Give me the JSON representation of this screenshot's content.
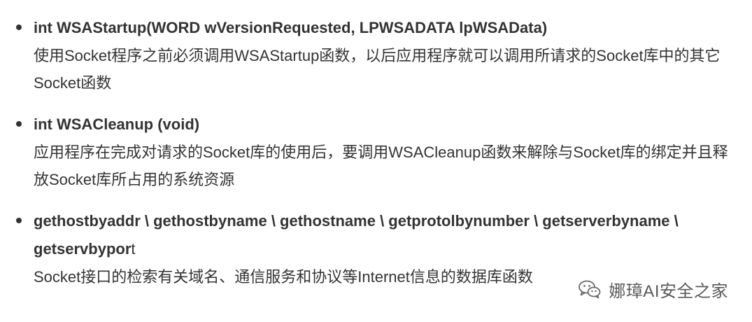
{
  "items": [
    {
      "signature": "int WSAStartup(WORD wVersionRequested, LPWSADATA lpWSAData)",
      "signature_tail": "",
      "description": "使用Socket程序之前必须调用WSAStartup函数，以后应用程序就可以调用所请求的Socket库中的其它Socket函数"
    },
    {
      "signature": "int WSACleanup (void)",
      "signature_tail": "",
      "description": "应用程序在完成对请求的Socket库的使用后，要调用WSACleanup函数来解除与Socket库的绑定并且释放Socket库所占用的系统资源"
    },
    {
      "signature": "gethostbyaddr \\ gethostbyname \\ gethostname \\ getprotolbynumber \\ getserverbyname \\ getservbypor",
      "signature_tail": "t",
      "description": "Socket接口的检索有关域名、通信服务和协议等Internet信息的数据库函数"
    }
  ],
  "watermark": {
    "text": "娜璋AI安全之家",
    "icon": "wechat-icon"
  }
}
